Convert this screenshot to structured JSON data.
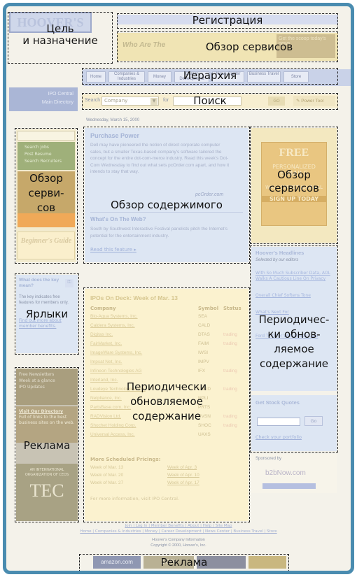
{
  "annotations": {
    "goal": [
      "Цель",
      "и назначение"
    ],
    "registration": "Регистрация",
    "services_overview": "Обзор сервисов",
    "hierarchy": "Иерархия",
    "search": "Поиск",
    "services_left": [
      "Обзор",
      "серви-",
      "сов"
    ],
    "content_overview": "Обзор содержимого",
    "services_right": [
      "Обзор",
      "сервисов"
    ],
    "shortcuts": "Ярлыки",
    "periodic_center": [
      "Периодически",
      "обновляемое",
      "содержание"
    ],
    "periodic_right": [
      "Периодичес-",
      "ки обнов-",
      "ляемое",
      "содержание"
    ],
    "advertising_left": "Реклама",
    "advertising_bottom": "Реклама"
  },
  "site": {
    "logo": "HOOVER'S",
    "banner_text": "Who Are The",
    "banner_promo": "Get the scoop today's news"
  },
  "nav": {
    "tabs": [
      "Home",
      "Companies & Industries",
      "Money",
      "Career Development",
      "News Center",
      "Business Travel",
      "Store"
    ],
    "left_links": [
      "IPO Central",
      "Main Directory"
    ]
  },
  "search": {
    "label": "Search",
    "select_value": "Company",
    "for_label": "for",
    "go": "GO",
    "power_tool": "Power Tool"
  },
  "date": "Wednesday, March 15, 2000",
  "left_services": [
    "Search Jobs",
    "Post Resume",
    "Search Recruiters"
  ],
  "left_beginners": "Beginner's Guide",
  "feature": {
    "title": "Purchase Power",
    "body": "Dell may have pioneered the notion of direct corporate computer sales, but a smaller Texas-based company's software tailored the concept for the entire dot-com-merce industry. Read this week's Dot-Com Wednesday to find out what sets pcOrder.com apart, and how it intends to stay that way.",
    "logo": "pcOrder.com",
    "web_title": "What's On The Web?",
    "web_body": "South by Southwest Interactive Festival panelists pitch the Internet's potential for the entertainment industry.",
    "read": "Read this feature"
  },
  "ad_right": {
    "free": "FREE",
    "line1": "PERSONALIZED",
    "line2": "E-MAILS",
    "line3": "WALL STREET JOURNAL",
    "signup": "SIGN UP TODAY"
  },
  "headlines": {
    "title": "Hoover's Headlines",
    "subtitle": "Selected by our editors",
    "items": [
      "With So Much Subscriber Data, AOL Walks A Cautious Line On Privacy",
      "Overall Chief Softens Tone",
      "What's Next For",
      "Ford To Offer Web-Ready Cars"
    ]
  },
  "stock": {
    "title": "Get Stock Quotes",
    "go": "Go",
    "portfolio": "Check your portfolio"
  },
  "sponsor": {
    "label": "Sponsored by",
    "name": "b2bNow.com"
  },
  "shortcuts_box": {
    "title": "What does the key mean?",
    "body": "The key indicates free features for members only.",
    "link": "Find out more about member benefits."
  },
  "ipo": {
    "title": "IPOs On Deck: Week of Mar. 13",
    "columns": [
      "Company",
      "Symbol",
      "Status"
    ],
    "rows": [
      [
        "Bio-Aqua Systems, Inc.",
        "SEA",
        ""
      ],
      [
        "Caldera Systems, Inc.",
        "CALD",
        ""
      ],
      [
        "Digitas Inc.",
        "DTAS",
        "trading"
      ],
      [
        "FairMarket, Inc.",
        "FAIM",
        "trading"
      ],
      [
        "ImageWare Systems, Inc.",
        "IWSI",
        ""
      ],
      [
        "Impsat Net, Inc.",
        "IMPV",
        ""
      ],
      [
        "Infineon Technologies AG",
        "IFX",
        "trading"
      ],
      [
        "Interland, Inc.",
        "",
        ""
      ],
      [
        "Loudeye Technologies, Inc.",
        "LOUD",
        "trading"
      ],
      [
        "Netpliance, Inc.",
        "NPLI",
        ""
      ],
      [
        "PartsBase.com, Inc.",
        "PRTS",
        ""
      ],
      [
        "RADVision Ltd.",
        "RVSN",
        "trading"
      ],
      [
        "Shochet Holding Corp.",
        "SHOC",
        "trading"
      ],
      [
        "Universal Access, Inc.",
        "UAXS",
        ""
      ]
    ],
    "more_title": "More Scheduled Pricings:",
    "more": [
      [
        "Week of Mar. 13",
        "Week of Apr. 3"
      ],
      [
        "Week of Mar. 20",
        "Week of Apr. 10"
      ],
      [
        "Week of Mar. 27",
        "Week of Apr. 17"
      ]
    ],
    "footer": "For more information, visit IPO Central."
  },
  "left_ads": {
    "line1": "Free Newsletters",
    "line2": "Week at a glance",
    "line3": "IPO Updates",
    "visit": "Visit Our Directory",
    "visit_body": "Full of links to the best business sites on the web.",
    "org": "AN INTERNATIONAL ORGANIZATION OF CEOS",
    "tec": "TEC"
  },
  "footer": {
    "links1": "Join | Log In | Member Benefits | About | Help | Site Map",
    "links2": "Home | Companies & Industries | Money | Career Development | News Center | Business Travel | Store",
    "company": "Hoover's Company Information",
    "copyright": "Copyright © 2000, Hoover's, Inc."
  },
  "bottom_ads": {
    "amazon": "amazon.com",
    "percent": "50%"
  }
}
